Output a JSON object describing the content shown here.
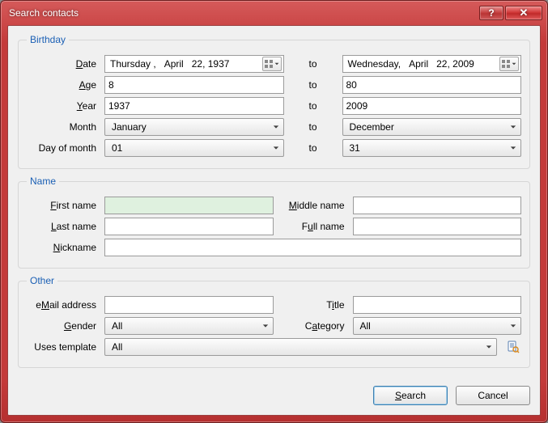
{
  "window": {
    "title": "Search contacts",
    "help_tooltip": "?",
    "close_tooltip": "✕"
  },
  "groups": {
    "birthday": {
      "legend": "Birthday",
      "date_label": "Date",
      "date_from": {
        "weekday": "Thursday ,",
        "month": "April",
        "day_year": "22, 1937"
      },
      "to_label": "to",
      "date_to": {
        "weekday": "Wednesday,",
        "month": "April",
        "day_year": "22, 2009"
      },
      "age_label": "Age",
      "age_from": "8",
      "age_to": "80",
      "year_label": "Year",
      "year_from": "1937",
      "year_to": "2009",
      "month_label": "Month",
      "month_from": "January",
      "month_to": "December",
      "dom_label": "Day of month",
      "dom_from": "01",
      "dom_to": "31"
    },
    "name": {
      "legend": "Name",
      "first_label": "First name",
      "first_value": "",
      "middle_label": "Middle name",
      "middle_value": "",
      "last_label": "Last name",
      "last_value": "",
      "full_label": "Full name",
      "full_value": "",
      "nick_label": "Nickname",
      "nick_value": ""
    },
    "other": {
      "legend": "Other",
      "email_label": "eMail address",
      "email_value": "",
      "title_label": "Title",
      "title_value": "",
      "gender_label": "Gender",
      "gender_value": "All",
      "category_label": "Category",
      "category_value": "All",
      "template_label": "Uses template",
      "template_value": "All"
    }
  },
  "buttons": {
    "search": "Search",
    "cancel": "Cancel"
  }
}
